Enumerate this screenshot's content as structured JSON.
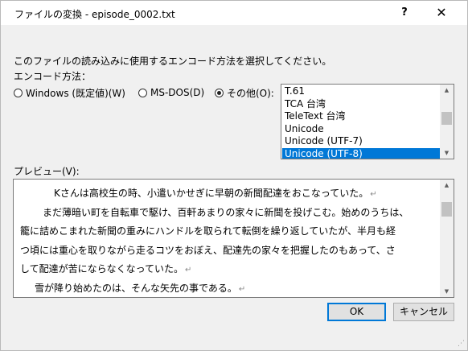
{
  "window": {
    "title": "ファイルの変換 - episode_0002.txt",
    "help_label": "?",
    "close_label": "✕"
  },
  "instruction": "このファイルの読み込みに使用するエンコード方法を選択してください。",
  "encoding_label": "エンコード方法：",
  "radios": [
    {
      "label": "Windows (既定値)(W)",
      "checked": false
    },
    {
      "label": "MS-DOS(D)",
      "checked": false
    },
    {
      "label": "その他(O):",
      "checked": true
    }
  ],
  "encoding_list": {
    "items": [
      "T.61",
      "TCA 台湾",
      "TeleText 台湾",
      "Unicode",
      "Unicode (UTF-7)",
      "Unicode (UTF-8)"
    ],
    "selected_index": 5
  },
  "preview_label": "プレビュー(V):",
  "preview_lines": [
    "Kさんは高校生の時、小遣いかせぎに早朝の新聞配達をおこなっていた。",
    "まだ薄暗い町を自転車で駆け、百軒あまりの家々に新聞を投げこむ。始めのうちは、",
    "籠に詰めこまれた新聞の重みにハンドルを取られて転倒を繰り返していたが、半月も経",
    "つ頃には重心を取りながら走るコツをおぼえ、配達先の家々を把握したのもあって、さ",
    "して配達が苦にならなくなっていた。",
    "雪が降り始めたのは、そんな矢先の事である。"
  ],
  "return_mark": "↵",
  "buttons": {
    "ok": "OK",
    "cancel": "キャンセル"
  },
  "colors": {
    "selection": "#0078d7",
    "dialog_bg": "#f0f0f0",
    "titlebar_bg": "#ffffff"
  }
}
